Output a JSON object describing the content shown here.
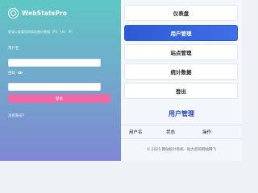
{
  "brand": {
    "name": "WebStatsPro",
    "icon": "target-logo-icon"
  },
  "login": {
    "subtitle": "登录以查看您的网站统计数据（PV、UV、IP）",
    "username_label": "用户名",
    "username_value": "",
    "password_label": "密码",
    "password_value": "",
    "submit_label": "登录",
    "register_text": "没有账号?"
  },
  "nav": {
    "items": [
      {
        "label": "仪表盘",
        "active": false
      },
      {
        "label": "用户管理",
        "active": true
      },
      {
        "label": "站点管理",
        "active": false
      },
      {
        "label": "统计数据",
        "active": false
      },
      {
        "label": "登出",
        "active": false
      }
    ]
  },
  "users": {
    "title": "用户管理",
    "columns": [
      "用户名",
      "状态",
      "操作"
    ]
  },
  "footer": {
    "text": "© 2025 网站统计系统 - 助力您的网站腾飞"
  },
  "colors": {
    "accent": "#2e5ad6",
    "login_button": "#ec6aa6",
    "title": "#2746b5"
  }
}
